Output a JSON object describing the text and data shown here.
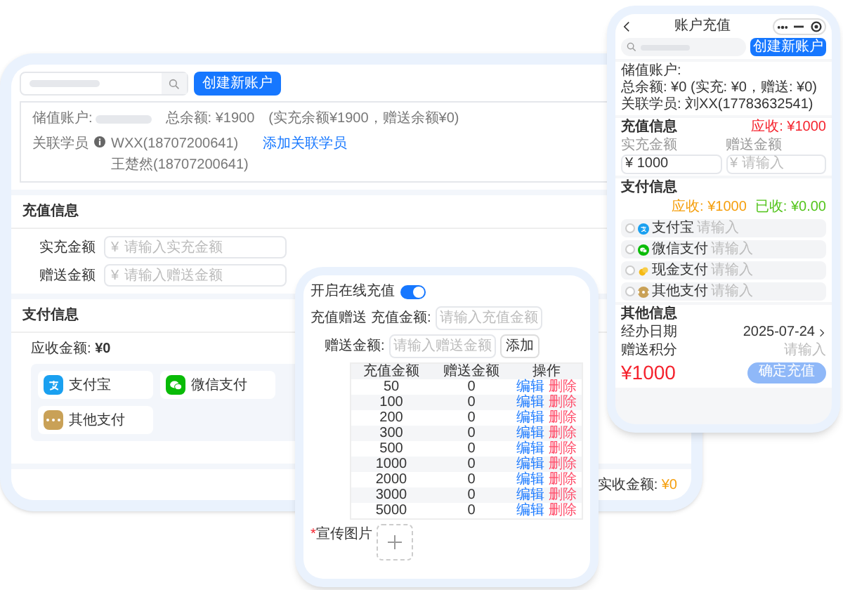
{
  "desktop": {
    "create_button": "创建新账户",
    "account": {
      "label": "储值账户:",
      "total_label": "总余额:",
      "total": "¥1900",
      "detail": "(实充余额¥1900，赠送余额¥0)",
      "students_label": "关联学员",
      "students": [
        "WXX(18707200641)",
        "王楚然(18707200641)"
      ],
      "add_link": "添加关联学员"
    },
    "recharge": {
      "title": "充值信息",
      "fields": [
        {
          "label": "实充金额",
          "prefix": "¥",
          "placeholder": "请输入实充金额"
        },
        {
          "label": "赠送金额",
          "prefix": "¥",
          "placeholder": "请输入赠送金额"
        }
      ]
    },
    "payment": {
      "title": "支付信息",
      "due_label": "应收金额:",
      "due": "¥0",
      "methods": [
        {
          "kind": "alipay",
          "label": "支付宝"
        },
        {
          "kind": "wechat",
          "label": "微信支付"
        },
        {
          "kind": "other",
          "label": "其他支付"
        }
      ]
    },
    "footer": {
      "label": "实收金额:",
      "value": "¥0"
    }
  },
  "settings": {
    "online_label": "开启在线充值",
    "online_on": true,
    "gift_label": "充值赠送",
    "amount_label": "充值金额:",
    "amount_placeholder": "请输入充值金额",
    "gift_amount_label": "赠送金额:",
    "gift_placeholder": "请输入赠送金额",
    "add_button": "添加",
    "table": {
      "columns": [
        "充值金额",
        "赠送金额",
        "操作"
      ],
      "rows": [
        {
          "amount": "50",
          "gift": "0",
          "edit": "编辑",
          "delete": "删除"
        },
        {
          "amount": "100",
          "gift": "0",
          "edit": "编辑",
          "delete": "删除"
        },
        {
          "amount": "200",
          "gift": "0",
          "edit": "编辑",
          "delete": "删除"
        },
        {
          "amount": "300",
          "gift": "0",
          "edit": "编辑",
          "delete": "删除"
        },
        {
          "amount": "500",
          "gift": "0",
          "edit": "编辑",
          "delete": "删除"
        },
        {
          "amount": "1000",
          "gift": "0",
          "edit": "编辑",
          "delete": "删除"
        },
        {
          "amount": "2000",
          "gift": "0",
          "edit": "编辑",
          "delete": "删除"
        },
        {
          "amount": "3000",
          "gift": "0",
          "edit": "编辑",
          "delete": "删除"
        },
        {
          "amount": "5000",
          "gift": "0",
          "edit": "编辑",
          "delete": "删除"
        }
      ]
    },
    "image_required": "*",
    "image_label": "宣传图片"
  },
  "phone": {
    "title": "账户充值",
    "create_button": "创建新账户",
    "info": [
      "储值账户:",
      "总余额: ¥0  (实充: ¥0，赠送: ¥0)",
      "关联学员: 刘XX(17783632541)"
    ],
    "recharge": {
      "title": "充值信息",
      "due": "应收: ¥1000",
      "fields": [
        {
          "label": "实充金额",
          "value": "¥ 1000"
        },
        {
          "label": "赠送金额",
          "placeholder": "¥ 请输入"
        }
      ]
    },
    "payment": {
      "title": "支付信息",
      "due": "应收: ¥1000",
      "paid": "已收: ¥0.00",
      "methods": [
        {
          "kind": "alipay",
          "label": "支付宝",
          "placeholder": "请输入",
          "checked": false
        },
        {
          "kind": "wechat",
          "label": "微信支付",
          "placeholder": "请输入",
          "checked": false
        },
        {
          "kind": "cash",
          "label": "现金支付",
          "placeholder": "请输入",
          "checked": false
        },
        {
          "kind": "other",
          "label": "其他支付",
          "placeholder": "请输入",
          "checked": false
        }
      ]
    },
    "other": {
      "title": "其他信息",
      "date_label": "经办日期",
      "date": "2025-07-24",
      "points_label": "赠送积分",
      "points_placeholder": "请输入"
    },
    "total": "¥1000",
    "confirm_button": "确定充值"
  }
}
